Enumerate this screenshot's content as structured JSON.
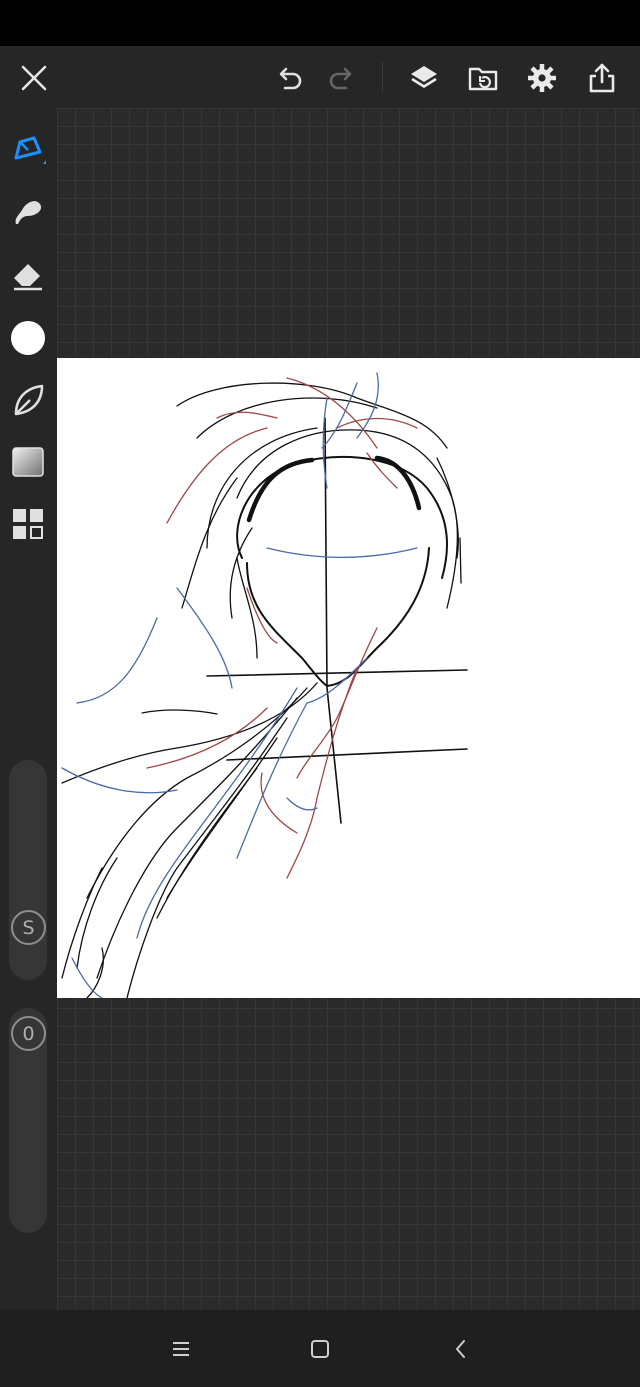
{
  "toolbar": {
    "close_icon": "close-icon",
    "undo_icon": "undo-icon",
    "redo_icon": "redo-icon",
    "layers_icon": "layers-icon",
    "import_icon": "import-folder-icon",
    "settings_icon": "gear-icon",
    "share_icon": "share-icon"
  },
  "tools": [
    {
      "name": "pen",
      "icon": "pen-icon",
      "active": true
    },
    {
      "name": "smudge",
      "icon": "smudge-icon"
    },
    {
      "name": "eraser",
      "icon": "eraser-icon"
    },
    {
      "name": "color",
      "icon": "color-circle",
      "color": "#ffffff"
    },
    {
      "name": "lasso",
      "icon": "lasso-icon"
    },
    {
      "name": "gradient",
      "icon": "gradient-icon"
    },
    {
      "name": "panels",
      "icon": "panels-icon"
    }
  ],
  "brush_size": {
    "label": "S",
    "level": 0.0
  },
  "brush_opacity": {
    "label": "0",
    "level": 0.0
  },
  "colors": {
    "accent": "#1e90ff",
    "sketch_black": "#111111",
    "sketch_red": "#a04646",
    "sketch_blue": "#4a6aa8",
    "paper": "#ffffff"
  },
  "nav": {
    "menu_icon": "menu-icon",
    "home_icon": "home-icon",
    "back_icon": "back-icon"
  }
}
